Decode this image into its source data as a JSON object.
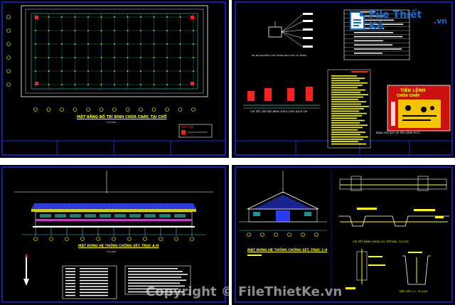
{
  "colors": {
    "sheet": "#000000",
    "frame": "#1a2bd8",
    "grid": "#1fd4d4",
    "accent": "#ffff00",
    "red": "#ff2020",
    "white": "#ffffff",
    "magenta": "#e040e0",
    "logo_blue": "#0a6fd6"
  },
  "sheet1": {
    "title": "MẶT BẰNG BỐ TRÍ BÌNH CHỮA CHÁY, TẠI CHỖ",
    "scale": "TL:1/100",
    "legend_title": "GHI CHÚ:"
  },
  "sheet2": {
    "schematic_caption": "SƠ ĐỒ NGUYÊN LÝ HỆ THỐNG BÁO CHÁY TỰ ĐỘNG",
    "extinguisher_caption": "CHI TIẾT LẮP ĐẶT BÌNH CHỮA CHÁY XÁCH TAY",
    "panel_heading": "TIÊU LỆNH",
    "panel_subheading": "CHỮA CHÁY",
    "panel_caption": "BẢNG NỘI QUY VÀ TIÊU LỆNH PCCC"
  },
  "sheet3": {
    "title": "MẶT ĐỨNG HỆ THỐNG CHỐNG SÉT, TRỤC A-H",
    "scale": "TL:1/100"
  },
  "sheet4": {
    "title": "MẶT ĐỨNG HỆ THỐNG CHỐNG SÉT, TRỤC 1-8",
    "detail_caption": "CHI TIẾT RÃNH CHÔN CỌC TIẾP ĐỊA - TL:1/25",
    "section_caption": "MẶT CẮT 1-1 - TL:1/25"
  },
  "logo": {
    "brand": "File Thiết Kế",
    "tld": ".vn"
  },
  "watermark": {
    "text": "Copyright © FileThietKe.vn"
  }
}
